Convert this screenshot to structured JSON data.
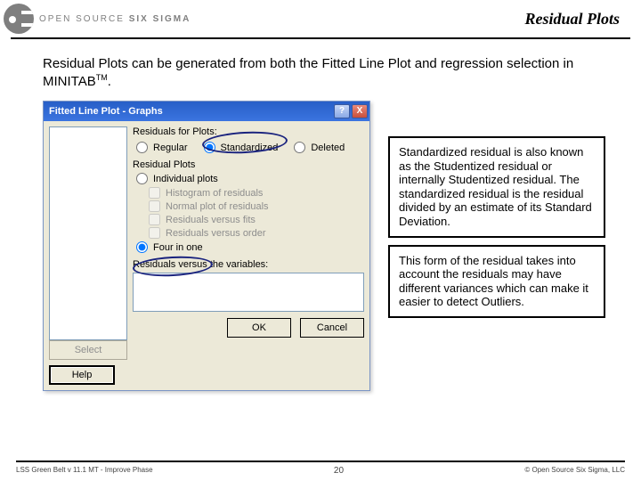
{
  "brand": {
    "left": "OPEN SOURCE",
    "right": "SIX SIGMA"
  },
  "slide_title": "Residual Plots",
  "intro_a": "Residual Plots can be generated from both the Fitted Line Plot and regression selection in MINITAB",
  "intro_tm": "TM",
  "intro_b": ".",
  "dialog": {
    "title": "Fitted Line Plot - Graphs",
    "qmark": "?",
    "xmark": "X",
    "group1": "Residuals for Plots:",
    "regular": "Regular",
    "standardized": "Standardized",
    "deleted": "Deleted",
    "group2": "Residual Plots",
    "individual": "Individual plots",
    "hist": "Histogram of residuals",
    "normal": "Normal plot of residuals",
    "vsfits": "Residuals versus fits",
    "vsorder": "Residuals versus order",
    "four": "Four in one",
    "vars": "Residuals versus the variables:",
    "select": "Select",
    "help": "Help",
    "ok": "OK",
    "cancel": "Cancel"
  },
  "box1": "Standardized residual is also known as the Studentized residual or internally Studentized residual. The standardized residual is the residual divided by an estimate of its Standard Deviation.",
  "box2": "This form of the residual takes into account the residuals may have different variances which can make it easier to detect Outliers.",
  "footer": {
    "left": "LSS Green Belt v 11.1 MT - Improve Phase",
    "page": "20",
    "right": "© Open Source Six Sigma, LLC"
  }
}
